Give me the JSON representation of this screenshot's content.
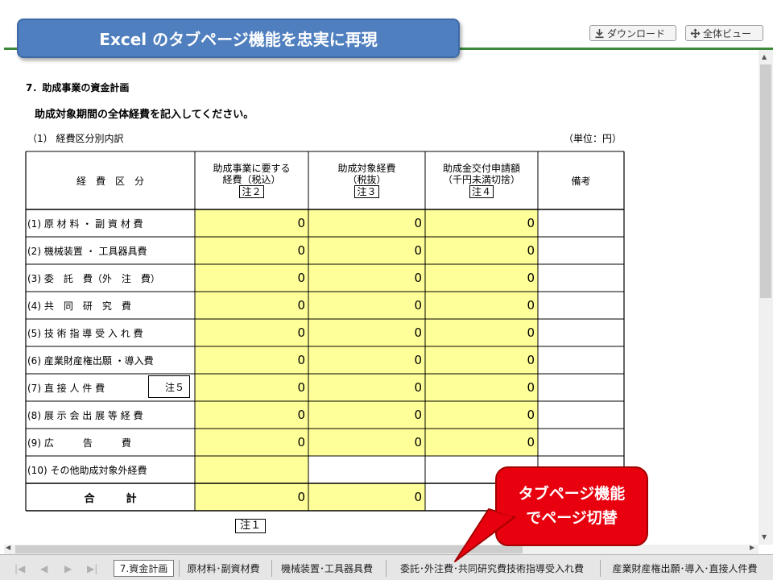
{
  "banner": {
    "title": "Excel のタブページ機能を忠実に再現"
  },
  "toolbar": {
    "download_label": "ダウンロード",
    "overview_label": "全体ビュー"
  },
  "sheet": {
    "section_title": "7．助成事業の資金計画",
    "instruction": "助成対象期間の全体経費を記入してください。",
    "subsection": "（1） 経費区分別内訳",
    "unit": "（単位：円）",
    "headers": {
      "category": "経　費　区　分",
      "col1": [
        "助成事業に要する",
        "経費（税込）"
      ],
      "col1_note": "注２",
      "col2": [
        "助成対象経費",
        "（税抜）"
      ],
      "col2_note": "注３",
      "col3": [
        "助成金交付申請額",
        "（千円未満切捨）"
      ],
      "col3_note": "注４",
      "remarks": "備考"
    },
    "rows": [
      {
        "label": "(1) 原 材 料 ・ 副 資 材 費",
        "v1": "0",
        "v2": "0",
        "v3": "0"
      },
      {
        "label": "(2) 機械装置 ・ 工具器具費",
        "v1": "0",
        "v2": "0",
        "v3": "0"
      },
      {
        "label": "(3) 委　託　費（外　注　費）",
        "v1": "0",
        "v2": "0",
        "v3": "0"
      },
      {
        "label": "(4) 共　同　研　究　費",
        "v1": "0",
        "v2": "0",
        "v3": "0"
      },
      {
        "label": "(5) 技 術 指 導 受 入 れ 費",
        "v1": "0",
        "v2": "0",
        "v3": "0"
      },
      {
        "label": "(6) 産業財産権出願 ・導入費",
        "v1": "0",
        "v2": "0",
        "v3": "0"
      },
      {
        "label": "(7) 直 接 人 件 費",
        "note": "注５",
        "v1": "0",
        "v2": "0",
        "v3": "0"
      },
      {
        "label": "(8) 展 示 会 出 展 等 経 費",
        "v1": "0",
        "v2": "0",
        "v3": "0"
      },
      {
        "label": "(9) 広　　　告　　　費",
        "v1": "0",
        "v2": "0",
        "v3": "0"
      },
      {
        "label": "(10) その他助成対象外経費",
        "v1": "",
        "v2": "",
        "v3": ""
      }
    ],
    "total": {
      "label": "合　　　計",
      "v1": "0",
      "v2": "0"
    },
    "footnote": "注１"
  },
  "tabs": [
    {
      "label": "7.資金計画",
      "active": true
    },
    {
      "label": "原材料･副資材費"
    },
    {
      "label": "機械装置･工具器具費"
    },
    {
      "label": "委託･外注費･共同研究費技術指導受入れ費"
    },
    {
      "label": "産業財産権出願･導入･直接人件費"
    }
  ],
  "callout": {
    "line1": "タブページ機能",
    "line2": "でページ切替"
  },
  "colors": {
    "banner": "#4f7fbf",
    "input_cell": "#ffff99",
    "callout": "#e8000e",
    "toolbar_line": "#3b8a3b"
  }
}
